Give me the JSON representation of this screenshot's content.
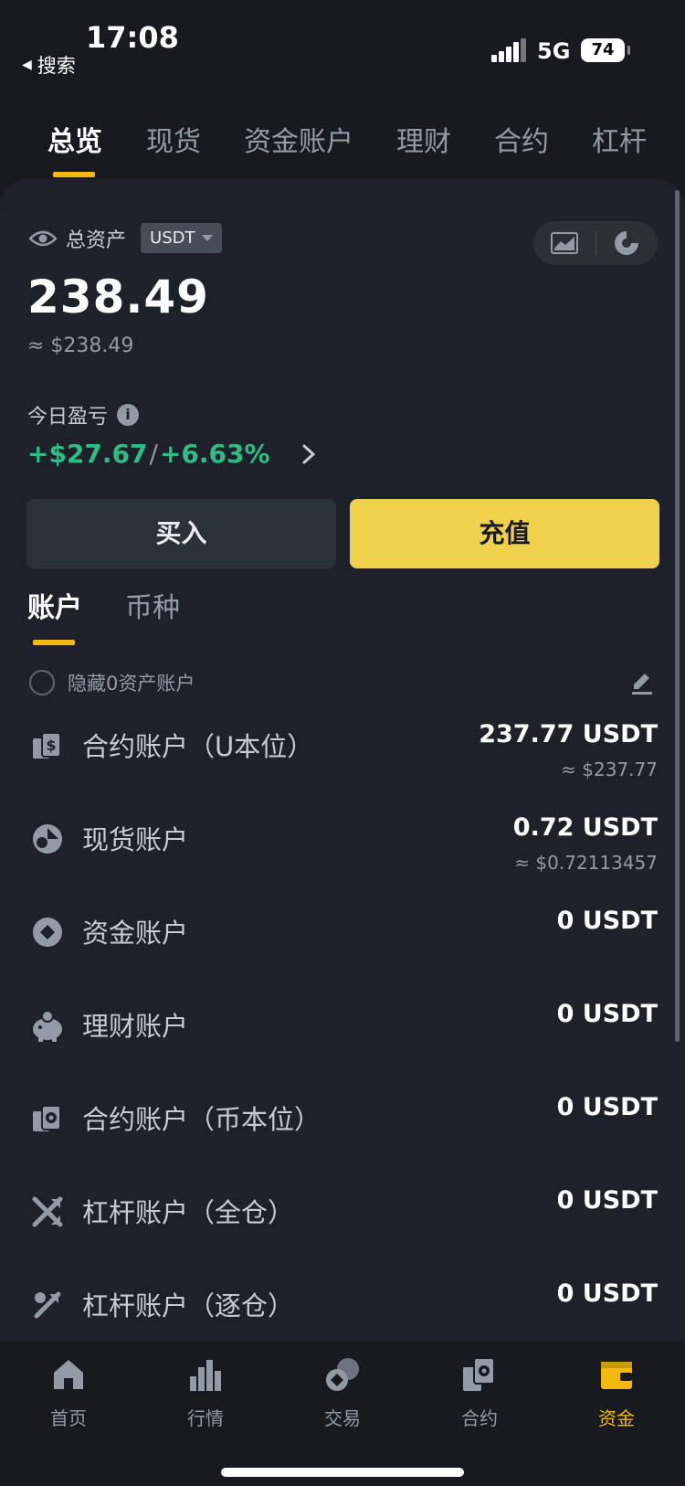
{
  "status_bar": {
    "time": "17:08",
    "back_label": "搜索",
    "network": "5G",
    "battery": "74"
  },
  "top_tabs": [
    {
      "label": "总览"
    },
    {
      "label": "现货"
    },
    {
      "label": "资金账户"
    },
    {
      "label": "理财"
    },
    {
      "label": "合约"
    },
    {
      "label": "杠杆"
    }
  ],
  "overview": {
    "total_label": "总资产",
    "currency": "USDT",
    "total_value": "238.49",
    "total_usd": "≈ $238.49",
    "pnl_label": "今日盈亏",
    "pnl_amount": "+$27.67",
    "pnl_separator": "/",
    "pnl_percent": "+6.63%",
    "buy_label": "买入",
    "deposit_label": "充值"
  },
  "sub_tabs": [
    {
      "label": "账户"
    },
    {
      "label": "币种"
    }
  ],
  "hide_zero_label": "隐藏0资产账户",
  "accounts": [
    {
      "name": "合约账户（U本位）",
      "balance": "237.77 USDT",
      "usd": "≈ $237.77",
      "icon": "futures-usdm-icon"
    },
    {
      "name": "现货账户",
      "balance": "0.72 USDT",
      "usd": "≈ $0.72113457",
      "icon": "spot-icon"
    },
    {
      "name": "资金账户",
      "balance": "0 USDT",
      "usd": "",
      "icon": "funding-icon"
    },
    {
      "name": "理财账户",
      "balance": "0 USDT",
      "usd": "",
      "icon": "earn-piggy-icon"
    },
    {
      "name": "合约账户（币本位）",
      "balance": "0 USDT",
      "usd": "",
      "icon": "futures-coinm-icon"
    },
    {
      "name": "杠杆账户（全仓）",
      "balance": "0 USDT",
      "usd": "",
      "icon": "margin-cross-icon"
    },
    {
      "name": "杠杆账户（逐仓）",
      "balance": "0 USDT",
      "usd": "",
      "icon": "margin-isolated-icon"
    }
  ],
  "bottom_nav": [
    {
      "label": "首页",
      "icon": "home-icon"
    },
    {
      "label": "行情",
      "icon": "markets-icon"
    },
    {
      "label": "交易",
      "icon": "trade-icon"
    },
    {
      "label": "合约",
      "icon": "futures-icon"
    },
    {
      "label": "资金",
      "icon": "wallet-icon"
    }
  ],
  "colors": {
    "accent": "#f0b90b",
    "deposit_button": "#f0d14c",
    "positive": "#2ebd85",
    "background": "#181a20",
    "card": "#1e2129"
  }
}
